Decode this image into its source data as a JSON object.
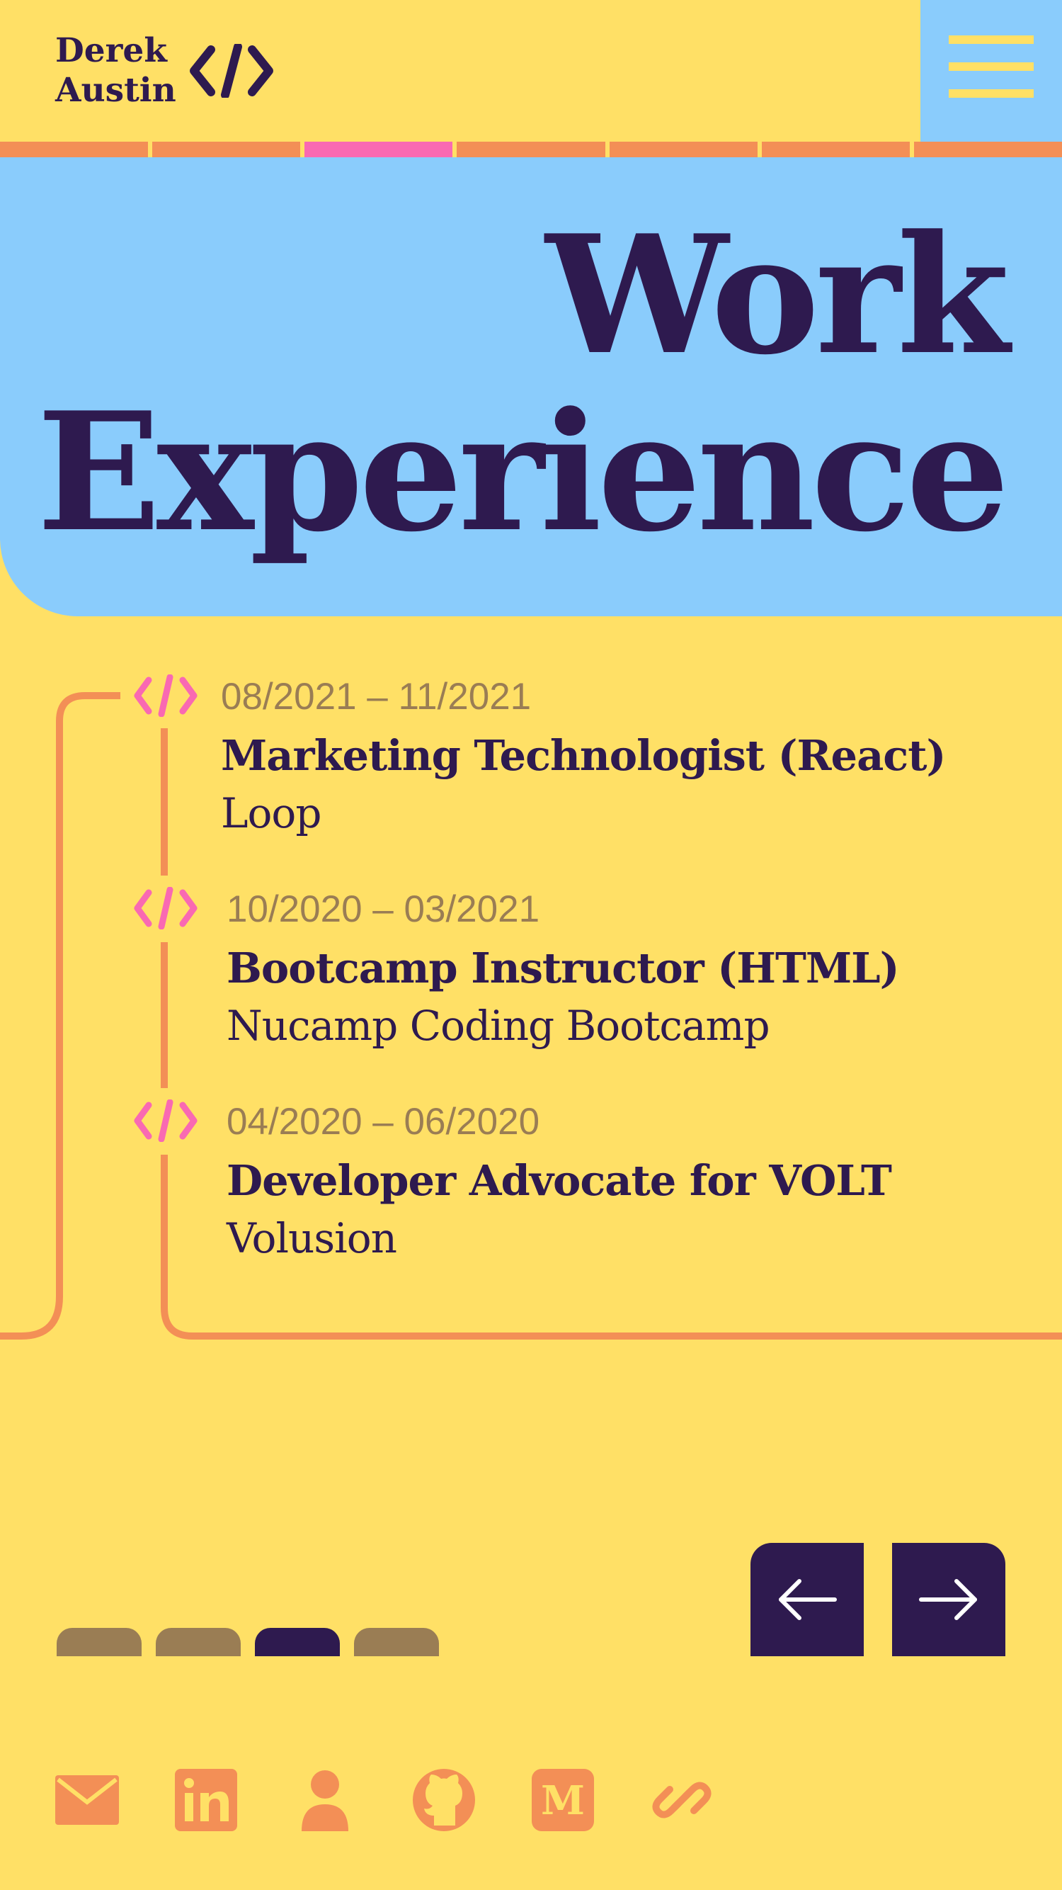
{
  "brand": {
    "name_line1": "Derek",
    "name_line2": "Austin",
    "logo_icon": "code-brackets-icon"
  },
  "nav": {
    "menu_icon": "hamburger-menu-icon",
    "progress_segments": 7,
    "active_segment": 3
  },
  "hero": {
    "title_line1": "Work",
    "title_line2": "Experience"
  },
  "jobs": [
    {
      "date": "08/2021 – 11/2021",
      "title": "Marketing Technologist (React)",
      "company": "Loop"
    },
    {
      "date": "10/2020 – 03/2021",
      "title": "Bootcamp Instructor (HTML)",
      "company": "Nucamp Coding Bootcamp"
    },
    {
      "date": "04/2020 – 06/2020",
      "title": "Developer Advocate for VOLT",
      "company": "Volusion"
    }
  ],
  "pager": {
    "total_pages": 4,
    "current_page": 3
  },
  "controls": {
    "prev_icon": "arrow-left-icon",
    "next_icon": "arrow-right-icon"
  },
  "socials": [
    "email-icon",
    "linkedin-icon",
    "person-icon",
    "github-icon",
    "medium-icon",
    "link-icon"
  ],
  "colors": {
    "background": "#ffe066",
    "hero": "#8accfc",
    "accent_orange": "#f38f56",
    "accent_pink": "#f969b2",
    "ink": "#2e1a4f",
    "muted": "#9a7d54"
  }
}
